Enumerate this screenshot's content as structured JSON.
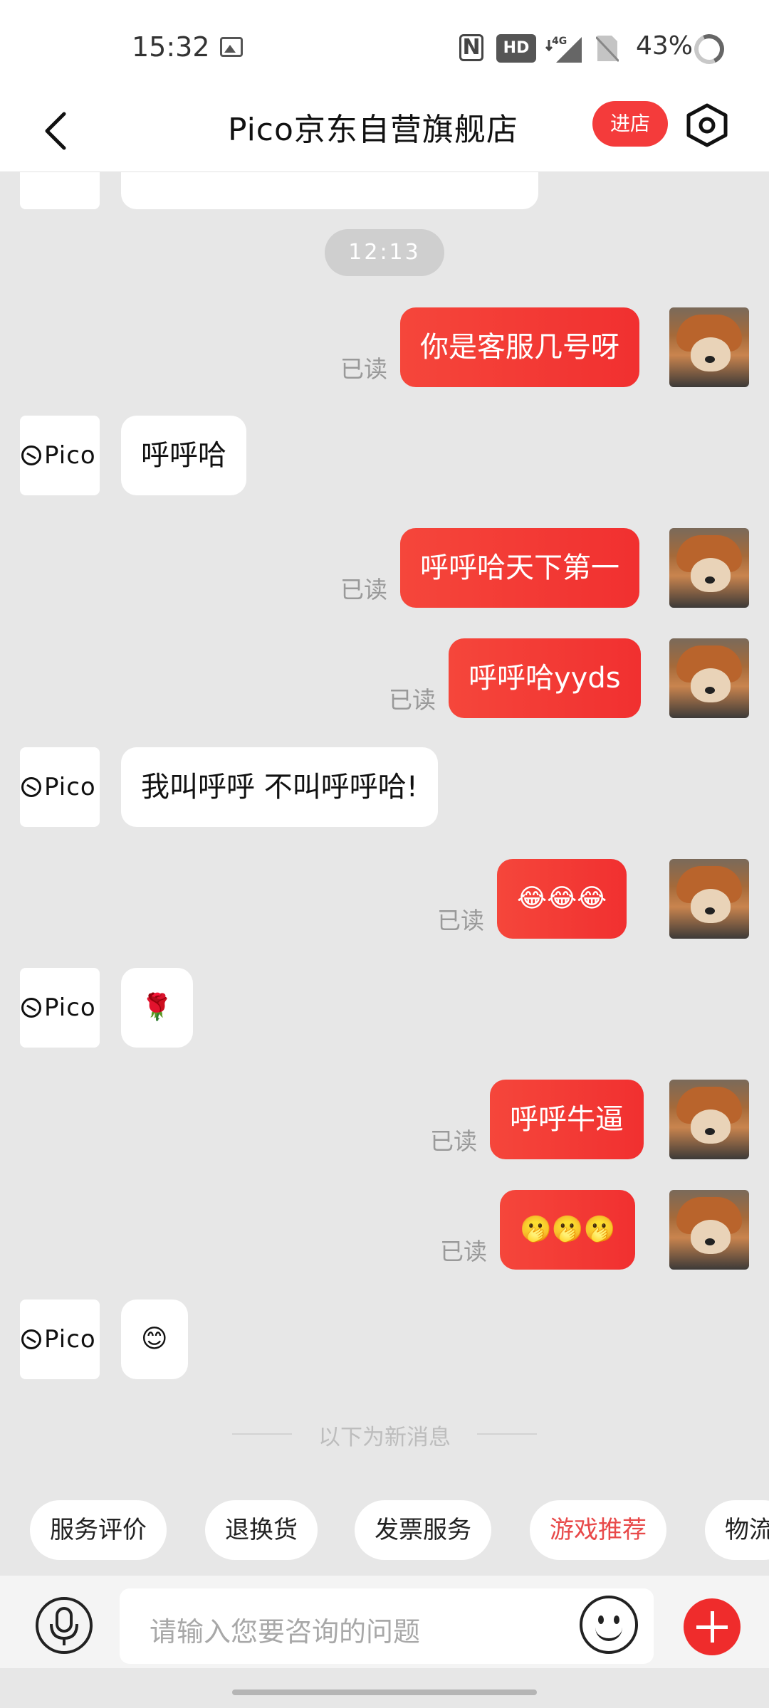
{
  "status_bar": {
    "time": "15:32",
    "hd_label": "HD",
    "network_label": "4G",
    "battery_percent": "43%"
  },
  "header": {
    "title": "Pico京东自营旗舰店",
    "enter_store_label": "进店",
    "back_icon": "chevron-left-icon",
    "settings_icon": "hexagon-settings-icon"
  },
  "chat": {
    "timestamp": "12:13",
    "read_label": "已读",
    "shop_logo_text": "Pico",
    "messages": [
      {
        "sender": "user",
        "text": "你是客服几号呀",
        "read": true
      },
      {
        "sender": "shop",
        "text": "呼呼哈"
      },
      {
        "sender": "user",
        "text": "呼呼哈天下第一",
        "read": true
      },
      {
        "sender": "user",
        "text": "呼呼哈yyds",
        "read": true
      },
      {
        "sender": "shop",
        "text": "我叫呼呼 不叫呼呼哈!"
      },
      {
        "sender": "user",
        "text": "😂😂😂",
        "read": true
      },
      {
        "sender": "shop",
        "text": "🌹"
      },
      {
        "sender": "user",
        "text": "呼呼牛逼",
        "read": true
      },
      {
        "sender": "user",
        "text": "🫢🫢🫢",
        "read": true
      },
      {
        "sender": "shop",
        "text": "😊"
      }
    ],
    "new_messages_divider": "以下为新消息"
  },
  "quick_replies": [
    {
      "label": "服务评价"
    },
    {
      "label": "退换货"
    },
    {
      "label": "发票服务"
    },
    {
      "label": "游戏推荐",
      "highlight": true
    },
    {
      "label": "物流"
    }
  ],
  "input_bar": {
    "placeholder": "请输入您要咨询的问题",
    "mic_icon": "microphone-icon",
    "emoji_icon": "smiley-icon",
    "plus_icon": "plus-icon"
  },
  "colors": {
    "accent_red": "#f13030",
    "highlight_chip": "#e84a4a",
    "chat_background": "#e7e7e7"
  }
}
